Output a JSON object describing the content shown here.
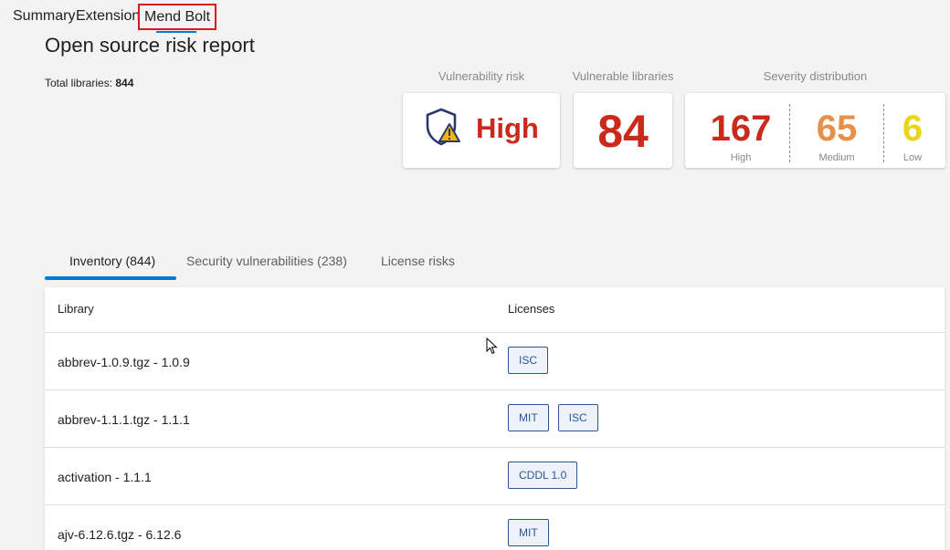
{
  "top_tabs": [
    {
      "label": "Summary"
    },
    {
      "label": "Extensions"
    },
    {
      "label": "Mend Bolt"
    }
  ],
  "report": {
    "title": "Open source risk report",
    "total_label": "Total libraries: ",
    "total_value": "844"
  },
  "cards": {
    "risk": {
      "title": "Vulnerability risk",
      "value": "High",
      "icon": "shield-warning-icon",
      "color": "#c92a1b"
    },
    "vulnerable": {
      "title": "Vulnerable libraries",
      "value": "84",
      "color": "#c92a1b"
    },
    "severity": {
      "title": "Severity distribution",
      "items": [
        {
          "value": "167",
          "label": "High",
          "color": "#c92a1b"
        },
        {
          "value": "65",
          "label": "Medium",
          "color": "#e8904a"
        },
        {
          "value": "6",
          "label": "Low",
          "color": "#e8d61c"
        }
      ]
    }
  },
  "tabs": [
    {
      "label": "Inventory (844)",
      "active": true
    },
    {
      "label": "Security vulnerabilities (238)",
      "active": false
    },
    {
      "label": "License risks",
      "active": false
    }
  ],
  "table": {
    "headers": {
      "library": "Library",
      "licenses": "Licenses"
    },
    "rows": [
      {
        "library": "abbrev-1.0.9.tgz - 1.0.9",
        "licenses": [
          "ISC"
        ]
      },
      {
        "library": "abbrev-1.1.1.tgz - 1.1.1",
        "licenses": [
          "MIT",
          "ISC"
        ]
      },
      {
        "library": "activation - 1.1.1",
        "licenses": [
          "CDDL 1.0"
        ]
      },
      {
        "library": "ajv-6.12.6.tgz - 6.12.6",
        "licenses": [
          "MIT"
        ]
      }
    ]
  },
  "colors": {
    "accent": "#0078d4",
    "highlight_border": "#e0141e",
    "badge_border": "#2b5797"
  }
}
